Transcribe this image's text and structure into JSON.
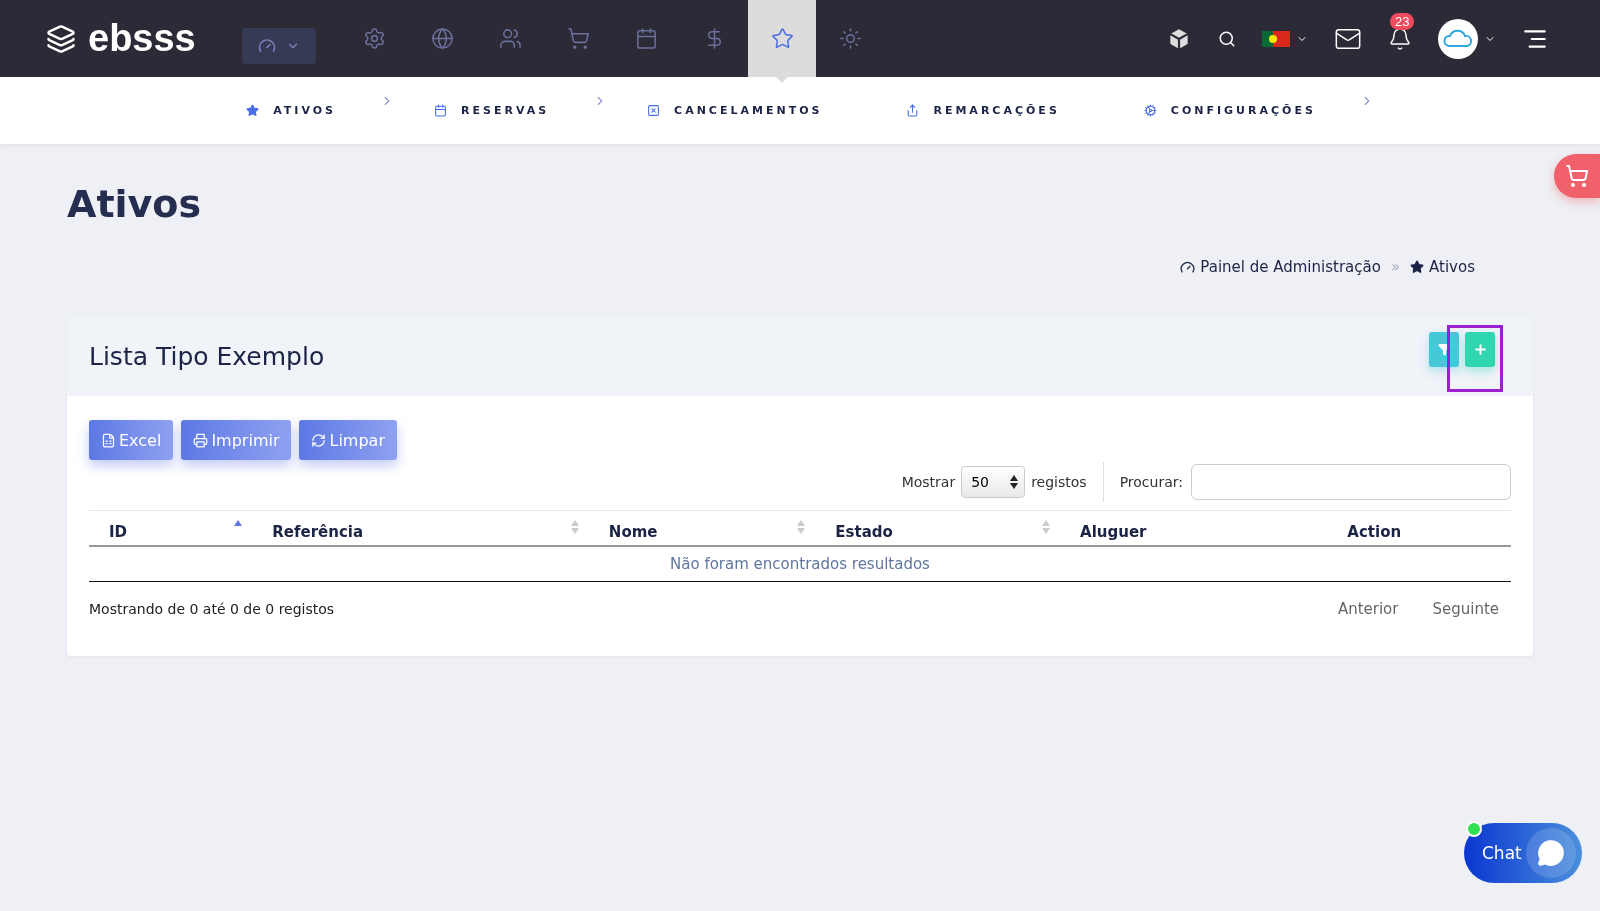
{
  "brand": {
    "name": "ebsss"
  },
  "topnav": {
    "icons": [
      {
        "kind": "settings",
        "selected": false
      },
      {
        "kind": "globe",
        "selected": false
      },
      {
        "kind": "users",
        "selected": false
      },
      {
        "kind": "cart",
        "selected": false
      },
      {
        "kind": "calendar",
        "selected": false
      },
      {
        "kind": "dollar",
        "selected": false
      },
      {
        "kind": "star",
        "selected": true
      },
      {
        "kind": "sun",
        "selected": false
      }
    ],
    "notifications": "23"
  },
  "subnav": [
    {
      "kind": "star",
      "label": "ATIVOS",
      "arrow": true
    },
    {
      "kind": "calendar",
      "label": "RESERVAS",
      "arrow": true
    },
    {
      "kind": "cancel",
      "label": "CANCELAMENTOS",
      "arrow": false
    },
    {
      "kind": "share",
      "label": "REMARCAÇÕES",
      "arrow": false
    },
    {
      "kind": "cogs",
      "label": "CONFIGURAÇÕES",
      "arrow": true
    }
  ],
  "page": {
    "title": "Ativos",
    "breadcrumb": [
      "Painel de Administração",
      "»",
      "Ativos"
    ]
  },
  "card": {
    "title": "Lista Tipo Exemplo",
    "highlighted_add": true,
    "buttons": [
      {
        "kind": "excel",
        "label": "Excel"
      },
      {
        "kind": "print",
        "label": "Imprimir"
      },
      {
        "kind": "refresh",
        "label": "Limpar"
      }
    ],
    "length": {
      "before": "Mostrar",
      "value": "50",
      "after": "registos"
    },
    "search_label": "Procurar:",
    "columns": [
      {
        "label": "ID",
        "sortable": true,
        "sorted": true
      },
      {
        "label": "Referência",
        "sortable": true,
        "sorted": false
      },
      {
        "label": "Nome",
        "sortable": true,
        "sorted": false
      },
      {
        "label": "Estado",
        "sortable": true,
        "sorted": false
      },
      {
        "label": "Aluguer",
        "sortable": false
      },
      {
        "label": "Action",
        "sortable": false
      }
    ],
    "empty": "Não foram encontrados resultados",
    "info": "Mostrando de 0 até 0 de 0 registos",
    "pager": [
      "Anterior",
      "Seguinte"
    ]
  },
  "chat": {
    "label": "Chat",
    "online": true
  }
}
